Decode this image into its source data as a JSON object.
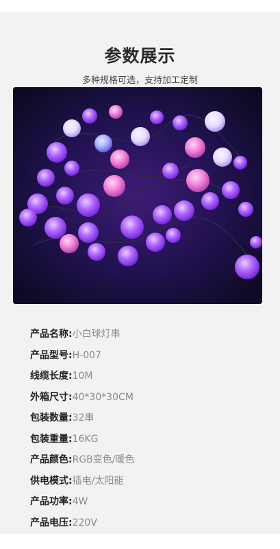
{
  "header": {
    "title": "参数展示",
    "subtitle": "多种规格可选，支持加工定制"
  },
  "photo": {
    "subject": "purple-pink-white-ball-string-lights"
  },
  "specs": [
    {
      "label": "产品名称:",
      "value": "小白球灯串"
    },
    {
      "label": "产品型号:",
      "value": "H-007"
    },
    {
      "label": "线缆长度:",
      "value": "10M"
    },
    {
      "label": "外箱尺寸:",
      "value": "40*30*30CM"
    },
    {
      "label": "包装数量:",
      "value": "32串"
    },
    {
      "label": "包装重量:",
      "value": "16KG"
    },
    {
      "label": "产品颜色:",
      "value": "RGB变色/暖色"
    },
    {
      "label": "供电模式:",
      "value": "插电/太阳能"
    },
    {
      "label": "产品功率:",
      "value": "4W"
    },
    {
      "label": "产品电压:",
      "value": "220V"
    }
  ],
  "colors": {
    "background": "#f2f2f2",
    "title": "#2b2b2b",
    "label": "#222222",
    "value": "#8a8a8a",
    "photo_bg": "#0b0b22"
  }
}
